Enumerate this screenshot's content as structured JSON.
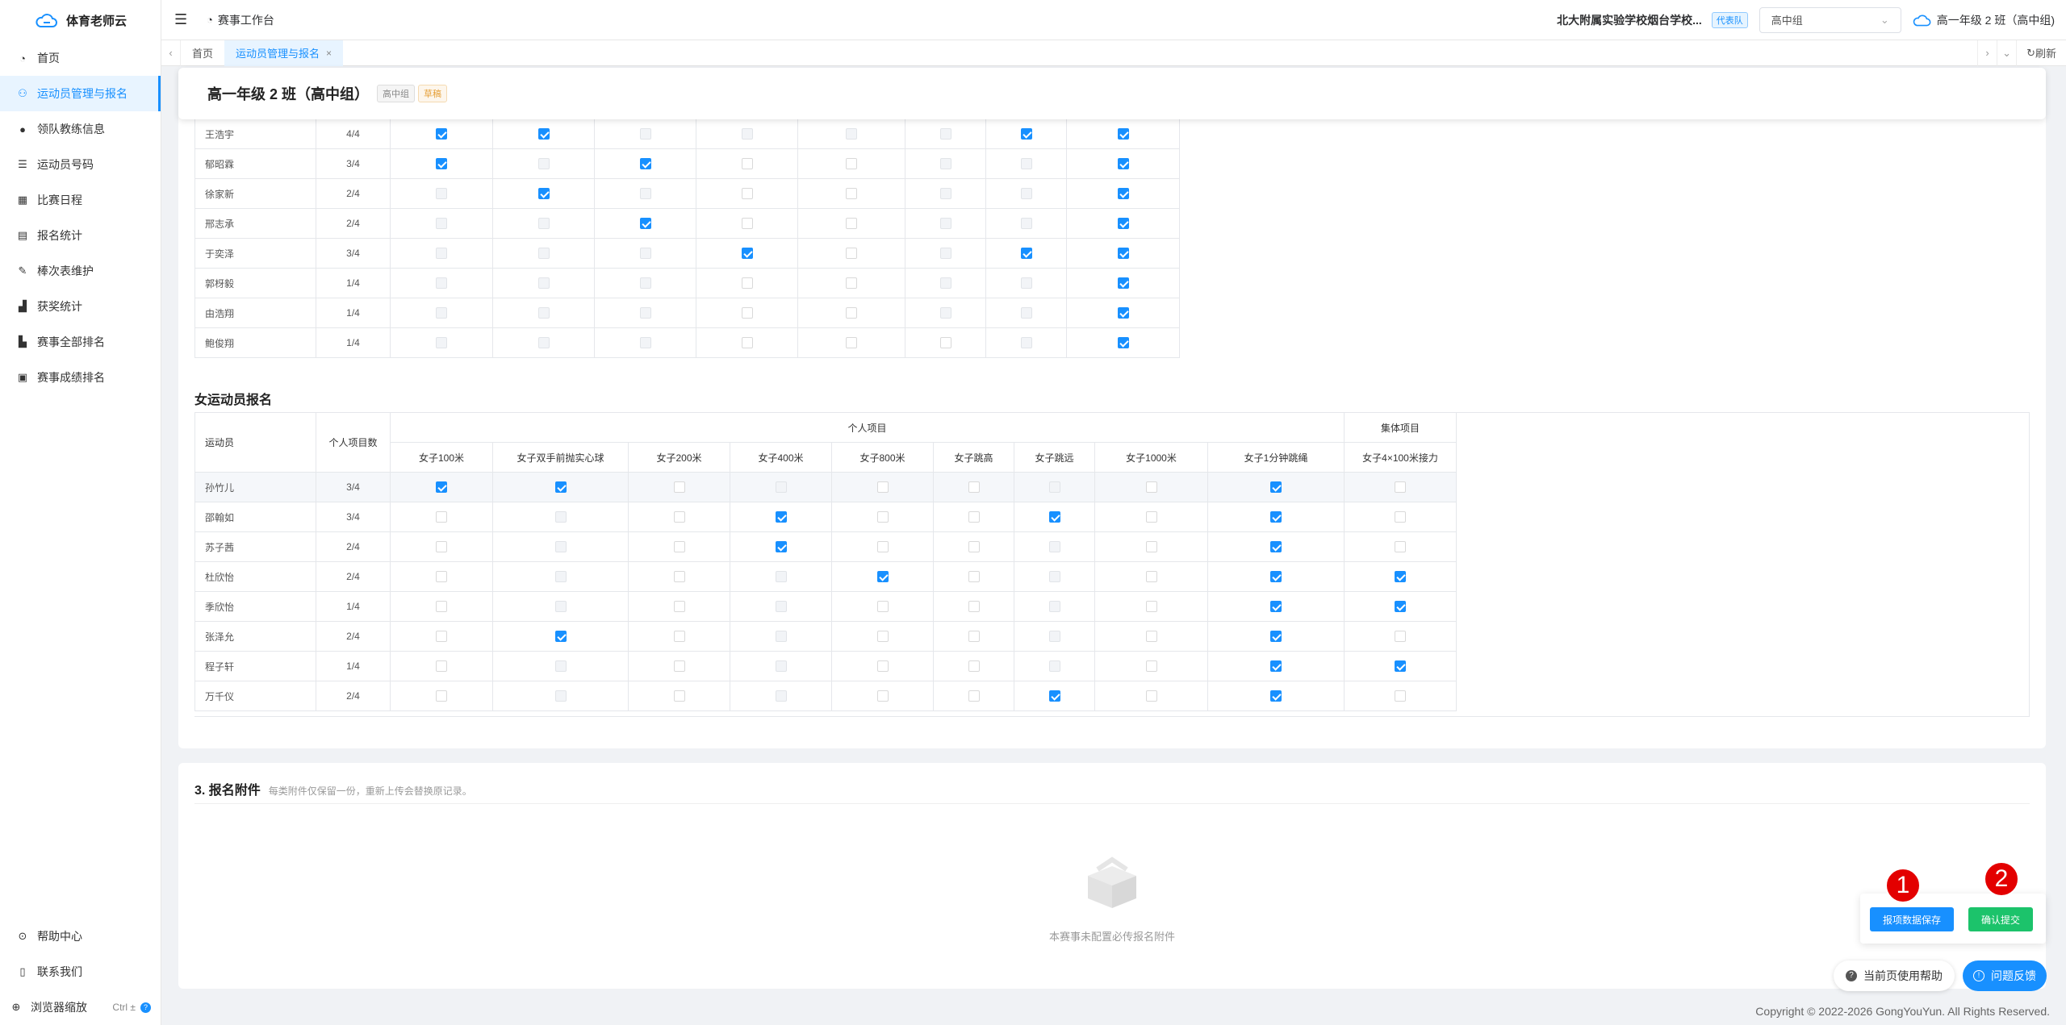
{
  "app": {
    "name": "体育老师云"
  },
  "sidebar": {
    "items": [
      {
        "label": "首页",
        "icon": "dashboard-icon"
      },
      {
        "label": "运动员管理与报名",
        "icon": "users-icon"
      },
      {
        "label": "领队教练信息",
        "icon": "user-icon"
      },
      {
        "label": "运动员号码",
        "icon": "list-icon"
      },
      {
        "label": "比赛日程",
        "icon": "calendar-icon"
      },
      {
        "label": "报名统计",
        "icon": "document-icon"
      },
      {
        "label": "棒次表维护",
        "icon": "edit-icon"
      },
      {
        "label": "获奖统计",
        "icon": "chart-icon"
      },
      {
        "label": "赛事全部排名",
        "icon": "ranking-icon"
      },
      {
        "label": "赛事成绩排名",
        "icon": "score-icon"
      }
    ],
    "help": "帮助中心",
    "contact": "联系我们",
    "zoom": "浏览器缩放",
    "zoom_shortcut": "Ctrl ±"
  },
  "topbar": {
    "workbench": "赛事工作台",
    "school": "北大附属实验学校烟台学校...",
    "team_tag": "代表队",
    "group_select": "高中组",
    "class_name": "高一年级 2 班（高中组)"
  },
  "tabs": {
    "home": "首页",
    "active": "运动员管理与报名",
    "close": "×",
    "refresh": "刷新"
  },
  "header": {
    "title": "高一年级 2 班（高中组）",
    "chip_group": "高中组",
    "chip_status": "草稿"
  },
  "male_table": {
    "rows": [
      {
        "name": "王浩宇",
        "count": "4/4",
        "cells": [
          "on",
          "on",
          "dis",
          "dis",
          "dis",
          "dis",
          "on",
          "on"
        ]
      },
      {
        "name": "郁昭霖",
        "count": "3/4",
        "cells": [
          "on",
          "dis",
          "on",
          "off",
          "off",
          "dis",
          "dis",
          "on"
        ]
      },
      {
        "name": "徐家新",
        "count": "2/4",
        "cells": [
          "dis",
          "on",
          "dis",
          "off",
          "off",
          "dis",
          "dis",
          "on"
        ]
      },
      {
        "name": "邢志承",
        "count": "2/4",
        "cells": [
          "dis",
          "dis",
          "on",
          "off",
          "off",
          "dis",
          "dis",
          "on"
        ]
      },
      {
        "name": "于奕泽",
        "count": "3/4",
        "cells": [
          "dis",
          "dis",
          "dis",
          "on",
          "off",
          "dis",
          "on",
          "on"
        ]
      },
      {
        "name": "郭枒毅",
        "count": "1/4",
        "cells": [
          "dis",
          "dis",
          "dis",
          "off",
          "off",
          "dis",
          "dis",
          "on"
        ]
      },
      {
        "name": "由浩翔",
        "count": "1/4",
        "cells": [
          "dis",
          "dis",
          "dis",
          "off",
          "off",
          "dis",
          "dis",
          "on"
        ]
      },
      {
        "name": "鲍俊翔",
        "count": "1/4",
        "cells": [
          "dis",
          "dis",
          "dis",
          "off",
          "off",
          "off",
          "dis",
          "on"
        ]
      }
    ]
  },
  "female_section": {
    "title": "女运动员报名",
    "h_athlete": "运动员",
    "h_count": "个人项目数",
    "h_individual": "个人项目",
    "h_team": "集体项目",
    "events": [
      "女子100米",
      "女子双手前抛实心球",
      "女子200米",
      "女子400米",
      "女子800米",
      "女子跳高",
      "女子跳远",
      "女子1000米",
      "女子1分钟跳绳",
      "女子4×100米接力"
    ],
    "rows": [
      {
        "name": "孙竹儿",
        "count": "3/4",
        "cells": [
          "on",
          "on",
          "off",
          "dis",
          "off",
          "off",
          "dis",
          "off",
          "on",
          "off"
        ]
      },
      {
        "name": "邵翰如",
        "count": "3/4",
        "cells": [
          "off",
          "dis",
          "off",
          "on",
          "off",
          "off",
          "on",
          "off",
          "on",
          "off"
        ]
      },
      {
        "name": "苏子茜",
        "count": "2/4",
        "cells": [
          "off",
          "dis",
          "off",
          "on",
          "off",
          "off",
          "dis",
          "off",
          "on",
          "off"
        ]
      },
      {
        "name": "杜欣怡",
        "count": "2/4",
        "cells": [
          "off",
          "dis",
          "off",
          "dis",
          "on",
          "off",
          "dis",
          "off",
          "on",
          "on"
        ]
      },
      {
        "name": "季欣怡",
        "count": "1/4",
        "cells": [
          "off",
          "dis",
          "off",
          "dis",
          "off",
          "off",
          "dis",
          "off",
          "on",
          "on"
        ]
      },
      {
        "name": "张泽允",
        "count": "2/4",
        "cells": [
          "off",
          "on",
          "off",
          "dis",
          "off",
          "off",
          "dis",
          "off",
          "on",
          "off"
        ]
      },
      {
        "name": "程子轩",
        "count": "1/4",
        "cells": [
          "off",
          "dis",
          "off",
          "dis",
          "off",
          "off",
          "dis",
          "off",
          "on",
          "on"
        ]
      },
      {
        "name": "万千仪",
        "count": "2/4",
        "cells": [
          "off",
          "dis",
          "off",
          "dis",
          "off",
          "off",
          "on",
          "off",
          "on",
          "off"
        ]
      }
    ]
  },
  "attachments": {
    "title": "3. 报名附件",
    "note": "每类附件仅保留一份，重新上传会替换原记录。",
    "empty": "本赛事未配置必传报名附件"
  },
  "actions": {
    "save": "报项数据保存",
    "submit": "确认提交",
    "badge1": "1",
    "badge2": "2",
    "help": "当前页使用帮助",
    "feedback": "问题反馈"
  },
  "footer": {
    "copyright": "Copyright © 2022-2026 GongYouYun. All Rights Reserved."
  },
  "colors": {
    "primary": "#1890ff",
    "success": "#1cc36b",
    "danger": "#e30000"
  }
}
